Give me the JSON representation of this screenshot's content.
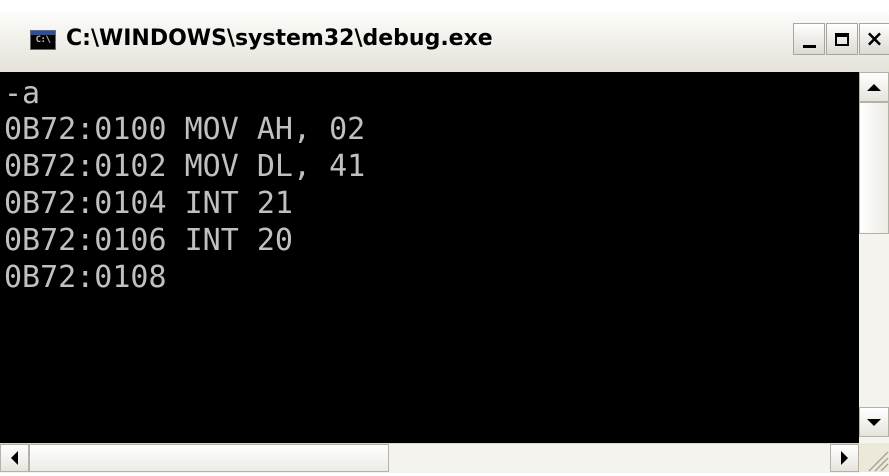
{
  "window": {
    "title": "C:\\WINDOWS\\system32\\debug.exe",
    "icon": "console-app-icon",
    "icon_text": "C:\\"
  },
  "console": {
    "text_color": "#c0c0c0",
    "background": "#000000",
    "lines": [
      "-a",
      "0B72:0100 MOV AH, 02",
      "0B72:0102 MOV DL, 41",
      "0B72:0104 INT 21",
      "0B72:0106 INT 20",
      "0B72:0108"
    ]
  },
  "controls": {
    "minimize": "minimize-icon",
    "maximize": "maximize-icon",
    "close": "close-icon",
    "close_glyph": "×"
  }
}
